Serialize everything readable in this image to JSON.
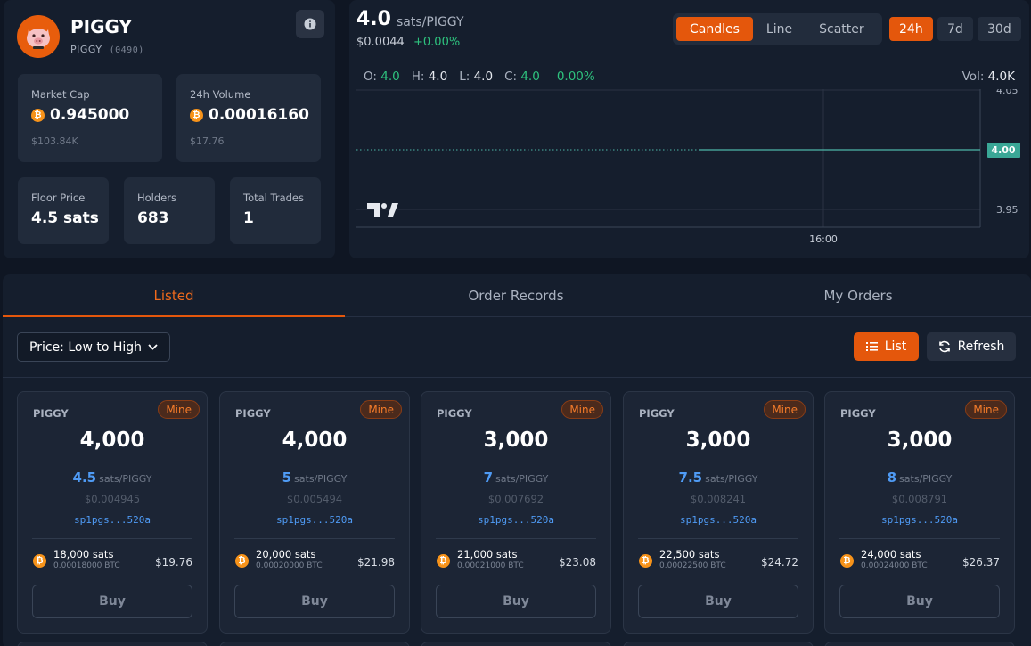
{
  "token": {
    "name": "PIGGY",
    "ticker": "PIGGY",
    "code": "(0490)",
    "icon": "pig-icon",
    "accent": "#e85d0c"
  },
  "stats": {
    "market_cap": {
      "label": "Market Cap",
      "value": "0.945000",
      "usd": "$103.84K"
    },
    "volume_24h": {
      "label": "24h Volume",
      "value": "0.00016160",
      "usd": "$17.76"
    },
    "floor_price": {
      "label": "Floor Price",
      "value": "4.5 sats"
    },
    "holders": {
      "label": "Holders",
      "value": "683"
    },
    "total_trades": {
      "label": "Total Trades",
      "value": "1"
    }
  },
  "chart": {
    "price": "4.0",
    "unit": "sats/PIGGY",
    "usd": "$0.0044",
    "change": "+0.00%",
    "types": [
      "Candles",
      "Line",
      "Scatter"
    ],
    "active_type": "Candles",
    "timeframes": [
      "24h",
      "7d",
      "30d"
    ],
    "active_timeframe": "24h",
    "ohlc": {
      "o_label": "O:",
      "o": "4.0",
      "h_label": "H:",
      "h": "4.0",
      "l_label": "L:",
      "l": "4.0",
      "c_label": "C:",
      "c": "4.0",
      "pct": "0.00%"
    },
    "vol_label": "Vol:",
    "vol": "4.0K",
    "y_ticks": [
      "4.05",
      "4.00",
      "3.95"
    ],
    "current_label": "4.00",
    "x_tick": "16:00"
  },
  "chart_data": {
    "type": "line",
    "x": [
      "16:00"
    ],
    "series": [
      {
        "values": [
          4.0
        ]
      }
    ],
    "ylim": [
      3.95,
      4.05
    ],
    "grid": true
  },
  "tabs": [
    "Listed",
    "Order Records",
    "My Orders"
  ],
  "active_tab": "Listed",
  "sort": {
    "value": "Price: Low to High"
  },
  "actions": {
    "list": "List",
    "refresh": "Refresh"
  },
  "listings": [
    {
      "ticker": "PIGGY",
      "badge": "Mine",
      "amount": "4,000",
      "price": "4.5",
      "unit": "sats/PIGGY",
      "usd": "$0.004945",
      "address": "sp1pgs...520a",
      "total_sats": "18,000 sats",
      "total_btc": "0.00018000 BTC",
      "total_usd": "$19.76",
      "buy": "Buy"
    },
    {
      "ticker": "PIGGY",
      "badge": "Mine",
      "amount": "4,000",
      "price": "5",
      "unit": "sats/PIGGY",
      "usd": "$0.005494",
      "address": "sp1pgs...520a",
      "total_sats": "20,000 sats",
      "total_btc": "0.00020000 BTC",
      "total_usd": "$21.98",
      "buy": "Buy"
    },
    {
      "ticker": "PIGGY",
      "badge": "Mine",
      "amount": "3,000",
      "price": "7",
      "unit": "sats/PIGGY",
      "usd": "$0.007692",
      "address": "sp1pgs...520a",
      "total_sats": "21,000 sats",
      "total_btc": "0.00021000 BTC",
      "total_usd": "$23.08",
      "buy": "Buy"
    },
    {
      "ticker": "PIGGY",
      "badge": "Mine",
      "amount": "3,000",
      "price": "7.5",
      "unit": "sats/PIGGY",
      "usd": "$0.008241",
      "address": "sp1pgs...520a",
      "total_sats": "22,500 sats",
      "total_btc": "0.00022500 BTC",
      "total_usd": "$24.72",
      "buy": "Buy"
    },
    {
      "ticker": "PIGGY",
      "badge": "Mine",
      "amount": "3,000",
      "price": "8",
      "unit": "sats/PIGGY",
      "usd": "$0.008791",
      "address": "sp1pgs...520a",
      "total_sats": "24,000 sats",
      "total_btc": "0.00024000 BTC",
      "total_usd": "$26.37",
      "buy": "Buy"
    }
  ]
}
